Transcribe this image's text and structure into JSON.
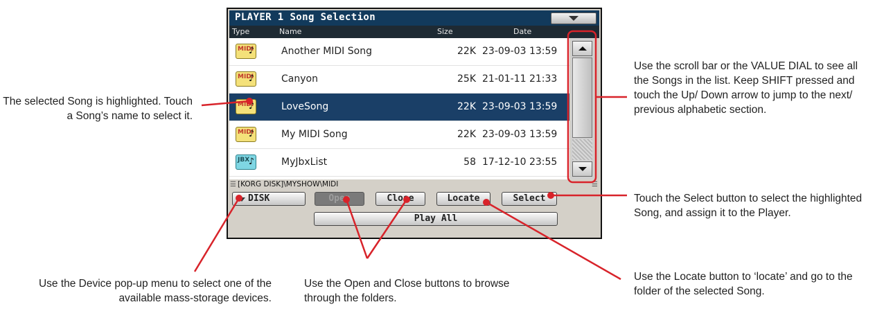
{
  "screen": {
    "title": "PLAYER 1 Song Selection",
    "columns": {
      "type": "Type",
      "name": "Name",
      "size": "Size",
      "date": "Date"
    },
    "songs": [
      {
        "type": "MIDI",
        "name": "Another MIDI Song",
        "size": "22K",
        "date": "23-09-03 13:59"
      },
      {
        "type": "MIDI",
        "name": "Canyon",
        "size": "25K",
        "date": "21-01-11 21:33"
      },
      {
        "type": "MIDI",
        "name": "LoveSong",
        "size": "22K",
        "date": "23-09-03 13:59"
      },
      {
        "type": "MIDI",
        "name": "My MIDI Song",
        "size": "22K",
        "date": "23-09-03 13:59"
      },
      {
        "type": "JBX",
        "name": "MyJbxList",
        "size": "58",
        "date": "17-12-10 23:55"
      }
    ],
    "selected_index": 2,
    "path": "[KORG DISK]\\MYSHOW\\MIDI",
    "buttons": {
      "disk": "DISK",
      "open": "Open",
      "close": "Close",
      "locate": "Locate",
      "select": "Select",
      "play_all": "Play All"
    },
    "icons": {
      "menu": "triangle-down-icon",
      "scroll_up": "arrow-up-icon",
      "scroll_down": "arrow-down-icon",
      "midi": "midi-file-icon",
      "jbx": "jbx-file-icon"
    }
  },
  "callouts": {
    "selected_song": "The selected Song is highlighted. Touch a Song’s name to select it.",
    "scrollbar": "Use the scroll bar or the VALUE DIAL to see all the Songs in the list. Keep SHIFT pressed and touch the Up/ Down arrow to jump to the next/ previous alphabetic section.",
    "select_button": "Touch the Select button to select the highlighted Song, and assign it to the Player.",
    "device_menu": "Use the Device pop-up menu to select one of the available mass-storage devices.",
    "open_close": "Use the Open and Close buttons to browse through the folders.",
    "locate": "Use the Locate button to ‘locate’ and go to the folder of the selected Song."
  },
  "colors": {
    "callout_red": "#d8232a",
    "selection": "#1a3f67",
    "titlebar": "#123a5c"
  }
}
